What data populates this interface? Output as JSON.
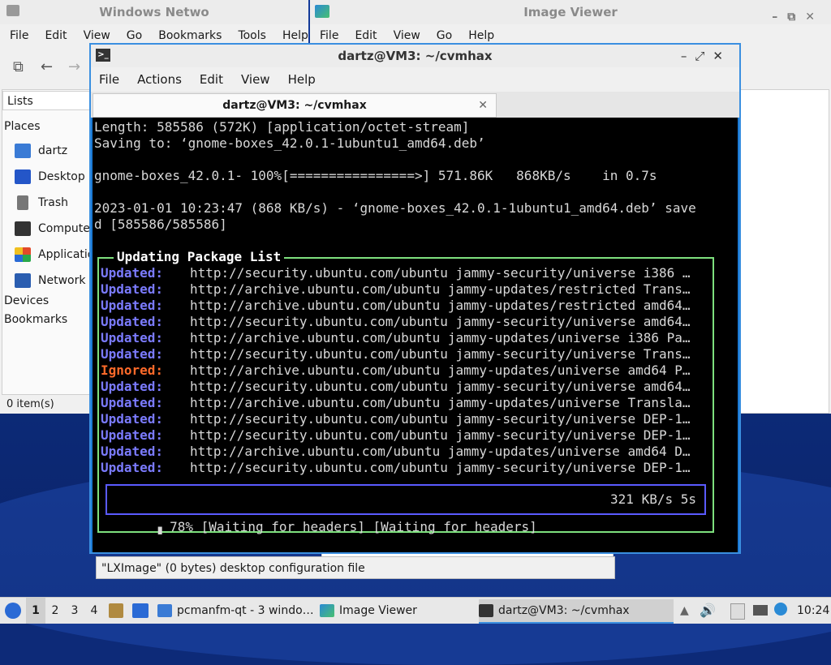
{
  "fm": {
    "title": "Windows Netwo",
    "menu": [
      "File",
      "Edit",
      "View",
      "Go",
      "Bookmarks",
      "Tools",
      "Help"
    ],
    "lists_label": "Lists",
    "places_header": "Places",
    "places": [
      {
        "label": "dartz",
        "icon": "home-folder-icon",
        "color": "#3a7bd5"
      },
      {
        "label": "Desktop",
        "icon": "desktop-icon",
        "color": "#2456c8"
      },
      {
        "label": "Trash",
        "icon": "trash-icon",
        "color": "#777777"
      },
      {
        "label": "Compute",
        "icon": "computer-icon",
        "color": "#333333"
      },
      {
        "label": "Applicatio",
        "icon": "applications-icon",
        "color": "#e24a2a"
      },
      {
        "label": "Network",
        "icon": "network-icon",
        "color": "#2a5db0"
      }
    ],
    "devices_header": "Devices",
    "bookmarks_header": "Bookmarks",
    "status": "0 item(s)"
  },
  "iv": {
    "title": "Image Viewer",
    "menu": [
      "File",
      "Edit",
      "View",
      "Go",
      "Help"
    ]
  },
  "fm_status": "\"LXImage\" (0 bytes) desktop configuration file",
  "term": {
    "title": "dartz@VM3: ~/cvmhax",
    "menu": [
      "File",
      "Actions",
      "Edit",
      "View",
      "Help"
    ],
    "tab_label": "dartz@VM3: ~/cvmhax",
    "lines": [
      "Length: 585586 (572K) [application/octet-stream]",
      "Saving to: ‘gnome-boxes_42.0.1-1ubuntu1_amd64.deb’",
      "",
      "gnome-boxes_42.0.1- 100%[================>] 571.86K   868KB/s    in 0.7s",
      "",
      "2023-01-01 10:23:47 (868 KB/s) - ‘gnome-boxes_42.0.1-1ubuntu1_amd64.deb’ save",
      "d [585586/585586]"
    ],
    "box_title": "Updating Package List",
    "rows": [
      {
        "status": "Updated:",
        "text": "http://security.ubuntu.com/ubuntu jammy-security/universe i386 …"
      },
      {
        "status": "Updated:",
        "text": "http://archive.ubuntu.com/ubuntu jammy-updates/restricted Trans…"
      },
      {
        "status": "Updated:",
        "text": "http://archive.ubuntu.com/ubuntu jammy-updates/restricted amd64…"
      },
      {
        "status": "Updated:",
        "text": "http://security.ubuntu.com/ubuntu jammy-security/universe amd64…"
      },
      {
        "status": "Updated:",
        "text": "http://archive.ubuntu.com/ubuntu jammy-updates/universe i386 Pa…"
      },
      {
        "status": "Updated:",
        "text": "http://security.ubuntu.com/ubuntu jammy-security/universe Trans…"
      },
      {
        "status": "Ignored:",
        "text": "http://archive.ubuntu.com/ubuntu jammy-updates/universe amd64 P…"
      },
      {
        "status": "Updated:",
        "text": "http://security.ubuntu.com/ubuntu jammy-security/universe amd64…"
      },
      {
        "status": "Updated:",
        "text": "http://archive.ubuntu.com/ubuntu jammy-updates/universe Transla…"
      },
      {
        "status": "Updated:",
        "text": "http://security.ubuntu.com/ubuntu jammy-security/universe DEP-1…"
      },
      {
        "status": "Updated:",
        "text": "http://security.ubuntu.com/ubuntu jammy-security/universe DEP-1…"
      },
      {
        "status": "Updated:",
        "text": "http://archive.ubuntu.com/ubuntu jammy-updates/universe amd64 D…"
      },
      {
        "status": "Updated:",
        "text": "http://security.ubuntu.com/ubuntu jammy-security/universe DEP-1…"
      }
    ],
    "progress_text": "▗ 78% [Waiting for headers] [Waiting for headers]",
    "progress_speed": "321 KB/s 5s"
  },
  "taskbar": {
    "workspaces": [
      "1",
      "2",
      "3",
      "4"
    ],
    "active_workspace": "1",
    "tasks": [
      {
        "label": "pcmanfm-qt - 3 windo…",
        "icon": "folder-icon"
      },
      {
        "label": "Image Viewer",
        "icon": "image-viewer-icon"
      },
      {
        "label": "dartz@VM3: ~/cvmhax",
        "icon": "terminal-icon"
      }
    ],
    "clock": "10:24"
  }
}
